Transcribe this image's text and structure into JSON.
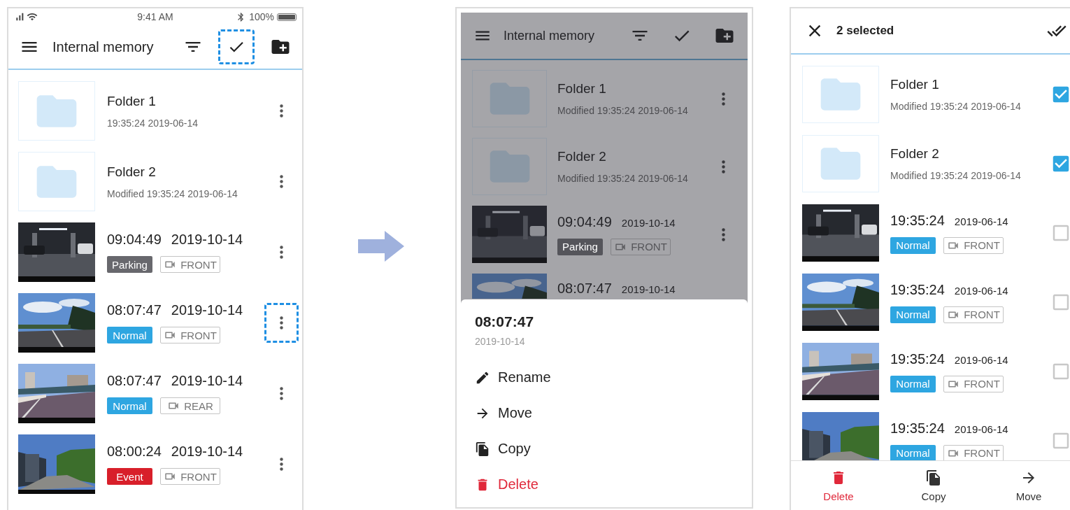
{
  "screens": [
    {
      "kind": "browse",
      "status_bar": {
        "time": "9:41 AM",
        "battery": "100%"
      },
      "app_bar": {
        "title": "Internal memory",
        "select_highlighted": true
      },
      "items": [
        {
          "kind": "folder",
          "name": "Folder 1",
          "modified": "19:35:24 2019-06-14",
          "menu_highlighted": false
        },
        {
          "kind": "folder",
          "name": "Folder 2",
          "modified": "Modified 19:35:24 2019-06-14",
          "menu_highlighted": false
        },
        {
          "kind": "video",
          "time": "09:04:49",
          "date": "2019-10-14",
          "tag": {
            "label": "Parking",
            "color": "#68686d"
          },
          "camera": "FRONT",
          "menu_highlighted": false
        },
        {
          "kind": "video",
          "time": "08:07:47",
          "date": "2019-10-14",
          "tag": {
            "label": "Normal",
            "color": "#2ea6e1"
          },
          "camera": "FRONT",
          "menu_highlighted": true
        },
        {
          "kind": "video",
          "time": "08:07:47",
          "date": "2019-10-14",
          "tag": {
            "label": "Normal",
            "color": "#2ea6e1"
          },
          "camera": "REAR",
          "menu_highlighted": false
        },
        {
          "kind": "video",
          "time": "08:00:24",
          "date": "2019-10-14",
          "tag": {
            "label": "Event",
            "color": "#d81f2a"
          },
          "camera": "FRONT",
          "menu_highlighted": false
        }
      ]
    },
    {
      "kind": "menu",
      "app_bar": {
        "title": "Internal memory"
      },
      "items": [
        {
          "kind": "folder",
          "name": "Folder 1",
          "modified": "Modified 19:35:24 2019-06-14"
        },
        {
          "kind": "folder",
          "name": "Folder 2",
          "modified": "Modified 19:35:24 2019-06-14"
        },
        {
          "kind": "video",
          "time": "09:04:49",
          "date": "2019-10-14",
          "tag": {
            "label": "Parking",
            "color": "#55555b"
          },
          "camera": "FRONT"
        },
        {
          "kind": "video",
          "time": "08:07:47",
          "date": "2019-10-14"
        }
      ],
      "sheet": {
        "title": "08:07:47",
        "subtitle": "2019-10-14",
        "actions": [
          {
            "kind": "rename",
            "label": "Rename"
          },
          {
            "kind": "move",
            "label": "Move"
          },
          {
            "kind": "copy",
            "label": "Copy"
          },
          {
            "kind": "delete",
            "label": "Delete"
          }
        ]
      }
    },
    {
      "kind": "select",
      "app_bar": {
        "title": "2 selected"
      },
      "items": [
        {
          "kind": "folder",
          "name": "Folder 1",
          "modified": "Modified 19:35:24 2019-06-14",
          "checked": true
        },
        {
          "kind": "folder",
          "name": "Folder 2",
          "modified": "Modified 19:35:24 2019-06-14",
          "checked": true
        },
        {
          "kind": "video",
          "time": "19:35:24",
          "date": "2019-06-14",
          "tag": {
            "label": "Normal",
            "color": "#2ea6e1"
          },
          "camera": "FRONT",
          "checked": false
        },
        {
          "kind": "video",
          "time": "19:35:24",
          "date": "2019-06-14",
          "tag": {
            "label": "Normal",
            "color": "#2ea6e1"
          },
          "camera": "FRONT",
          "checked": false
        },
        {
          "kind": "video",
          "time": "19:35:24",
          "date": "2019-06-14",
          "tag": {
            "label": "Normal",
            "color": "#2ea6e1"
          },
          "camera": "FRONT",
          "checked": false
        },
        {
          "kind": "video",
          "time": "19:35:24",
          "date": "2019-06-14",
          "tag": {
            "label": "Normal",
            "color": "#2ea6e1"
          },
          "camera": "FRONT",
          "checked": false
        }
      ],
      "bottom_actions": [
        {
          "kind": "delete",
          "label": "Delete"
        },
        {
          "kind": "copy",
          "label": "Copy"
        },
        {
          "kind": "move",
          "label": "Move"
        }
      ]
    }
  ]
}
